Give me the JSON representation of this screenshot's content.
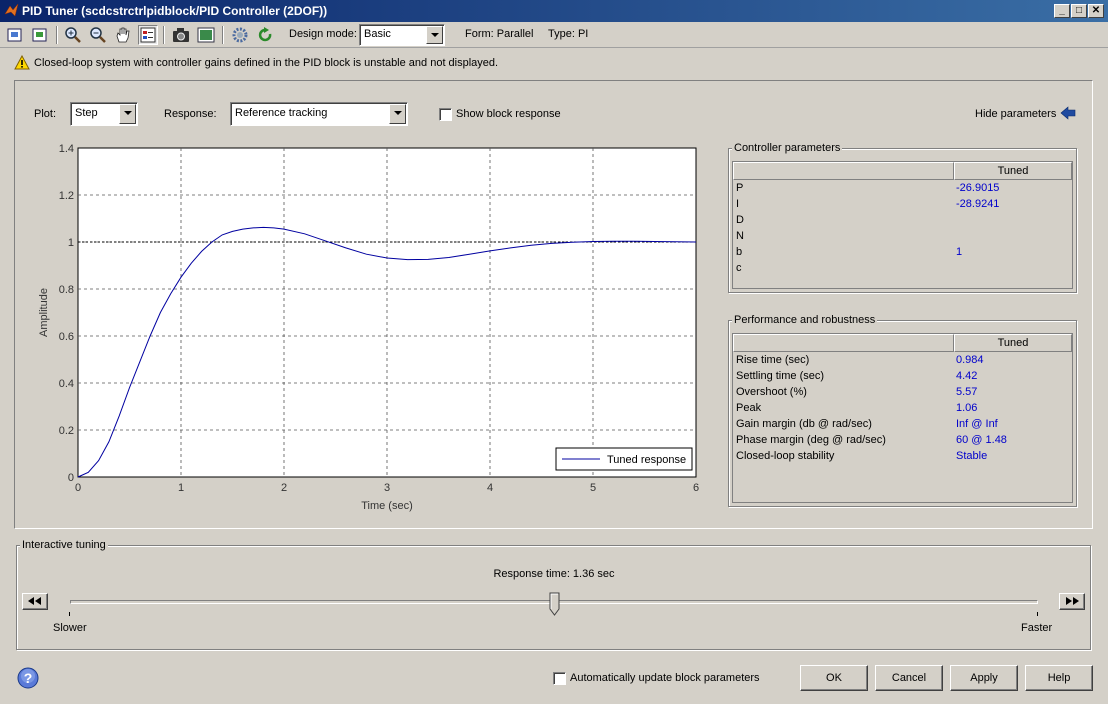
{
  "window": {
    "title": "PID Tuner (scdcstrctrlpidblock/PID Controller (2DOF))"
  },
  "toolbar": {
    "design_mode_label": "Design mode:",
    "design_mode_value": "Basic",
    "form_label": "Form: Parallel",
    "type_label": "Type: PI"
  },
  "warning": {
    "text": "Closed-loop system with controller gains defined in the PID block is unstable and not displayed."
  },
  "plot_controls": {
    "plot_label": "Plot:",
    "plot_value": "Step",
    "response_label": "Response:",
    "response_value": "Reference tracking",
    "show_block_response_label": "Show block response",
    "hide_parameters_label": "Hide parameters"
  },
  "chart_data": {
    "type": "line",
    "xlabel": "Time (sec)",
    "ylabel": "Amplitude",
    "xlim": [
      0,
      6
    ],
    "ylim": [
      0,
      1.4
    ],
    "xticks": [
      "0",
      "1",
      "2",
      "3",
      "4",
      "5",
      "6"
    ],
    "yticks": [
      "0",
      "0.2",
      "0.4",
      "0.6",
      "0.8",
      "1",
      "1.2",
      "1.4"
    ],
    "grid": true,
    "legend_position": "bottom-right",
    "reference_level": 1,
    "series": [
      {
        "name": "Tuned response",
        "color": "#0000a0",
        "x": [
          0,
          0.1,
          0.2,
          0.3,
          0.4,
          0.5,
          0.6,
          0.7,
          0.8,
          0.9,
          1.0,
          1.1,
          1.2,
          1.3,
          1.4,
          1.5,
          1.6,
          1.7,
          1.8,
          1.9,
          2.0,
          2.2,
          2.4,
          2.6,
          2.8,
          3.0,
          3.2,
          3.4,
          3.6,
          3.8,
          4.0,
          4.2,
          4.4,
          4.6,
          4.8,
          5.0,
          5.2,
          5.4,
          5.6,
          5.8,
          6.0
        ],
        "y": [
          0,
          0.02,
          0.07,
          0.15,
          0.26,
          0.38,
          0.49,
          0.6,
          0.7,
          0.78,
          0.85,
          0.91,
          0.96,
          1.0,
          1.03,
          1.045,
          1.055,
          1.06,
          1.062,
          1.06,
          1.055,
          1.035,
          1.005,
          0.975,
          0.948,
          0.932,
          0.925,
          0.926,
          0.934,
          0.948,
          0.962,
          0.975,
          0.986,
          0.994,
          0.999,
          1.002,
          1.003,
          1.003,
          1.002,
          1.001,
          1.0
        ]
      }
    ]
  },
  "controller_parameters": {
    "title": "Controller parameters",
    "column": "Tuned",
    "rows": [
      {
        "label": "P",
        "value": "-26.9015"
      },
      {
        "label": "I",
        "value": "-28.9241"
      },
      {
        "label": "D",
        "value": ""
      },
      {
        "label": "N",
        "value": ""
      },
      {
        "label": "b",
        "value": "1"
      },
      {
        "label": "c",
        "value": ""
      }
    ]
  },
  "performance": {
    "title": "Performance and robustness",
    "column": "Tuned",
    "rows": [
      {
        "label": "Rise time (sec)",
        "value": "0.984"
      },
      {
        "label": "Settling time (sec)",
        "value": "4.42"
      },
      {
        "label": "Overshoot (%)",
        "value": "5.57"
      },
      {
        "label": "Peak",
        "value": "1.06"
      },
      {
        "label": "Gain margin (db @ rad/sec)",
        "value": "Inf @ Inf"
      },
      {
        "label": "Phase margin (deg @ rad/sec)",
        "value": "60 @ 1.48"
      },
      {
        "label": "Closed-loop stability",
        "value": "Stable"
      }
    ]
  },
  "tuning": {
    "title": "Interactive tuning",
    "response_time_text": "Response time: 1.36 sec",
    "slower_label": "Slower",
    "faster_label": "Faster",
    "slider_fraction": 0.5
  },
  "footer": {
    "auto_update_label": "Automatically update block parameters",
    "ok": "OK",
    "cancel": "Cancel",
    "apply": "Apply",
    "help": "Help"
  }
}
